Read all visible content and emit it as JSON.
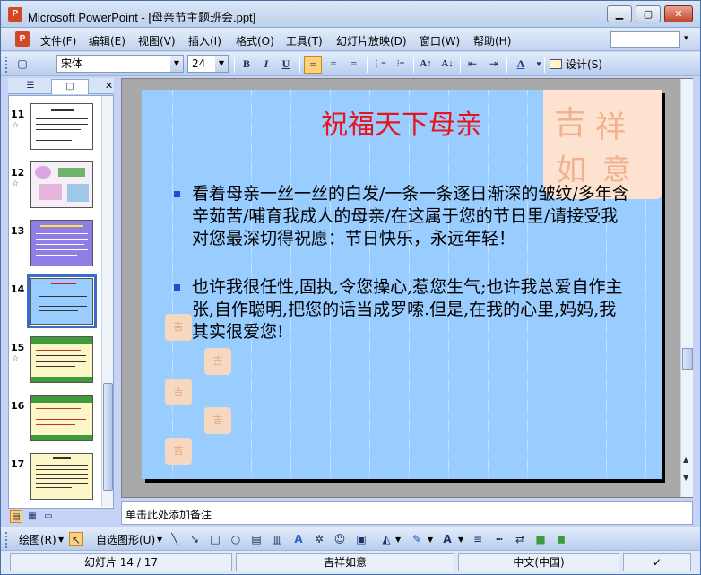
{
  "window": {
    "title": "Microsoft PowerPoint - [母亲节主题班会.ppt]",
    "app_icon_glyph": "P",
    "controls": {
      "minimize": "▁",
      "maximize": "▢",
      "close": "✕"
    }
  },
  "menu": {
    "items": [
      "文件(F)",
      "编辑(E)",
      "视图(V)",
      "插入(I)",
      "格式(O)",
      "工具(T)",
      "幻灯片放映(D)",
      "窗口(W)",
      "帮助(H)"
    ],
    "help_arrow": "▾"
  },
  "toolbar": {
    "font_name": "宋体",
    "font_size": "24",
    "bold": "B",
    "italic": "I",
    "underline": "U",
    "align_left": "≡",
    "align_center": "≡",
    "align_right": "≡",
    "numbered_list": "⋮≡",
    "bulleted_list": "⁝≡",
    "grow_font": "A↑",
    "shrink_font": "A↓",
    "decrease_indent": "⇤",
    "increase_indent": "⇥",
    "font_color": "A",
    "design_label": "设计(S)"
  },
  "slides_pane": {
    "tabs": [
      "☰",
      "▢"
    ],
    "close": "✕",
    "thumbnails": [
      {
        "number": "11",
        "star": "☆"
      },
      {
        "number": "12",
        "star": "☆"
      },
      {
        "number": "13",
        "star": ""
      },
      {
        "number": "14",
        "star": "",
        "selected": true
      },
      {
        "number": "15",
        "star": "☆"
      },
      {
        "number": "16",
        "star": ""
      },
      {
        "number": "17",
        "star": ""
      }
    ]
  },
  "slide": {
    "title": "祝福天下母亲",
    "bullets": [
      "看着母亲一丝一丝的白发/一条一条逐日渐深的皱纹/多年含辛茹苦/哺育我成人的母亲/在这属于您的节日里/请接受我对您最深切得祝愿：节日快乐，永远年轻！",
      "也许我很任性,固执,令您操心,惹您生气;也许我总爱自作主张,自作聪明,把您的话当成罗嗦.但是,在我的心里,妈妈,我其实很爱您!"
    ],
    "colors": {
      "background": "#99ccff",
      "title": "#e8141b",
      "bullet": "#1f4fd0"
    }
  },
  "notes": {
    "placeholder": "单击此处添加备注"
  },
  "drawing_toolbar": {
    "draw_menu": "绘图(R)",
    "autoshapes_menu": "自选图形(U)"
  },
  "status": {
    "slide_indicator": "幻灯片 14 / 17",
    "design_template": "吉祥如意",
    "language": "中文(中国)"
  }
}
